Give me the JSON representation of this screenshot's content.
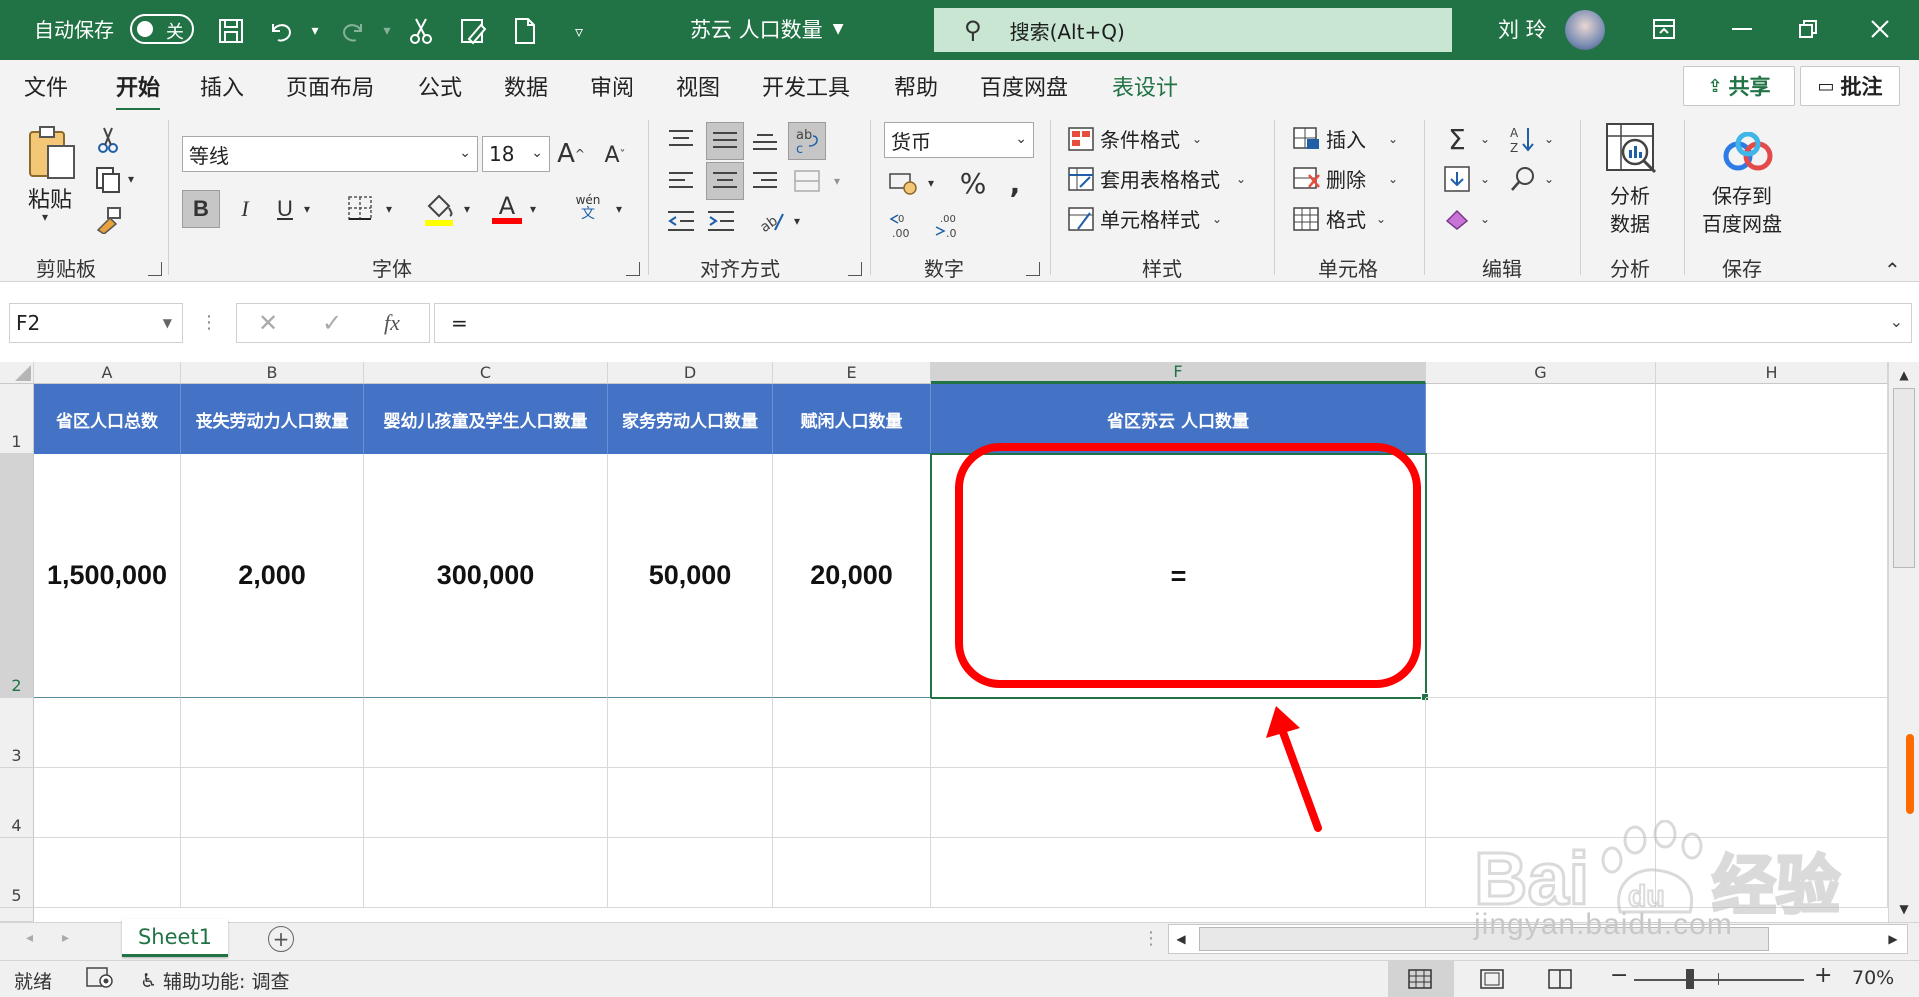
{
  "titlebar": {
    "autosave_label": "自动保存",
    "autosave_state": "关",
    "doc_title": "苏云 人口数量",
    "search_placeholder": "搜索(Alt+Q)",
    "username": "刘 玲",
    "bg_color": "#217346"
  },
  "tabs": [
    "文件",
    "开始",
    "插入",
    "页面布局",
    "公式",
    "数据",
    "审阅",
    "视图",
    "开发工具",
    "帮助",
    "百度网盘",
    "表设计"
  ],
  "active_tab": "开始",
  "share_label": "共享",
  "comment_label": "批注",
  "ribbon": {
    "clipboard": {
      "paste_label": "粘贴",
      "group_label": "剪贴板"
    },
    "font": {
      "font_name": "等线",
      "font_size": "18",
      "bold": "B",
      "italic": "I",
      "underline": "U",
      "phonetic": "wén",
      "phonetic_sub": "文",
      "color_letter": "A",
      "group_label": "字体"
    },
    "alignment": {
      "group_label": "对齐方式"
    },
    "number": {
      "format": "货币",
      "group_label": "数字"
    },
    "styles": {
      "conditional": "条件格式",
      "table_format": "套用表格格式",
      "cell_styles": "单元格样式",
      "group_label": "样式"
    },
    "cells": {
      "insert": "插入",
      "delete": "删除",
      "format": "格式",
      "group_label": "单元格"
    },
    "editing": {
      "group_label": "编辑"
    },
    "analysis": {
      "label_line1": "分析",
      "label_line2": "数据",
      "group_label": "分析"
    },
    "save": {
      "label_line1": "保存到",
      "label_line2": "百度网盘",
      "group_label": "保存"
    }
  },
  "formula_bar": {
    "name_box": "F2",
    "fx": "fx",
    "formula": "="
  },
  "grid": {
    "columns": [
      "A",
      "B",
      "C",
      "D",
      "E",
      "F",
      "G",
      "H"
    ],
    "rows": [
      "1",
      "2",
      "3",
      "4",
      "5"
    ],
    "header_row": [
      "省区人口总数",
      "丧失劳动力人口数量",
      "婴幼儿孩童及学生人口数量",
      "家务劳动人口数量",
      "赋闲人口数量",
      "省区苏云 人口数量"
    ],
    "data_row": [
      "1,500,000",
      "2,000",
      "300,000",
      "50,000",
      "20,000",
      "="
    ],
    "header_color": "#4472c4"
  },
  "sheet_tab": "Sheet1",
  "statusbar": {
    "ready": "就绪",
    "accessibility": "辅助功能: 调查",
    "zoom": "70%"
  },
  "watermark": {
    "text": "jingyan.baidu.com"
  }
}
